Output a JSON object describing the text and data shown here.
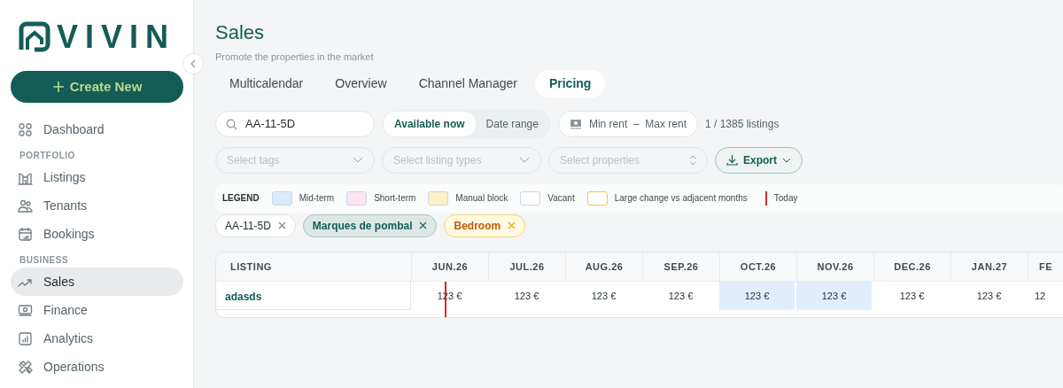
{
  "sidebar": {
    "logo": "VIVIN",
    "create_button": "Create New",
    "items": [
      {
        "kind": "item",
        "label": "Dashboard",
        "selected": false
      },
      {
        "kind": "section",
        "label": "PORTFOLIO"
      },
      {
        "kind": "item",
        "label": "Listings",
        "selected": false
      },
      {
        "kind": "item",
        "label": "Tenants",
        "selected": false
      },
      {
        "kind": "item",
        "label": "Bookings",
        "selected": false
      },
      {
        "kind": "section",
        "label": "BUSINESS"
      },
      {
        "kind": "item",
        "label": "Sales",
        "selected": true
      },
      {
        "kind": "item",
        "label": "Finance",
        "selected": false
      },
      {
        "kind": "item",
        "label": "Analytics",
        "selected": false
      },
      {
        "kind": "item",
        "label": "Operations",
        "selected": false
      }
    ]
  },
  "header": {
    "title": "Sales",
    "subtitle": "Promote the properties in the market"
  },
  "tabs": [
    {
      "label": "Multicalendar",
      "selected": false
    },
    {
      "label": "Overview",
      "selected": false
    },
    {
      "label": "Channel Manager",
      "selected": false
    },
    {
      "label": "Pricing",
      "selected": true
    }
  ],
  "search": {
    "value": "AA-11-5D"
  },
  "availability": [
    {
      "label": "Available now",
      "selected": true
    },
    {
      "label": "Date range",
      "selected": false
    }
  ],
  "rent": {
    "min": "Min rent",
    "separator": "–",
    "max": "Max rent"
  },
  "listing_count": "1 / 1385 listings",
  "filters": [
    {
      "placeholder": "Select tags",
      "kind": "dropdown"
    },
    {
      "placeholder": "Select listing types",
      "kind": "dropdown"
    },
    {
      "placeholder": "Select properties",
      "kind": "sort"
    }
  ],
  "export_button": "Export",
  "legend": {
    "title": "LEGEND",
    "items": [
      {
        "label": "Mid-term",
        "kind": "swatch",
        "color": "#dce9fc"
      },
      {
        "label": "Short-term",
        "kind": "swatch",
        "color": "#fce4f0"
      },
      {
        "label": "Manual block",
        "kind": "swatch",
        "color": "#fdf0c4"
      },
      {
        "label": "Vacant",
        "kind": "swatch",
        "color": "#ffffff"
      },
      {
        "label": "Large change vs adjacent months",
        "kind": "outline",
        "color": "#f2c744"
      },
      {
        "label": "Today",
        "kind": "line",
        "color": "#d9262c"
      }
    ]
  },
  "active_filters": [
    {
      "label": "AA-11-5D",
      "kind": "search"
    },
    {
      "label": "Marques de pombal",
      "kind": "property"
    },
    {
      "label": "Bedroom",
      "kind": "type"
    }
  ],
  "table": {
    "columns": [
      "LISTING",
      "JUN.26",
      "JUL.26",
      "AUG.26",
      "SEP.26",
      "OCT.26",
      "NOV.26",
      "DEC.26",
      "JAN.27",
      "FE"
    ],
    "rows": [
      {
        "cells": [
          {
            "text": "adasds",
            "kind": "listing"
          },
          {
            "text": "123 €",
            "kind": "vacant",
            "today": true
          },
          {
            "text": "123 €",
            "kind": "vacant"
          },
          {
            "text": "123 €",
            "kind": "vacant"
          },
          {
            "text": "123 €",
            "kind": "vacant"
          },
          {
            "text": "123 €",
            "kind": "mid-term"
          },
          {
            "text": "123 €",
            "kind": "mid-term"
          },
          {
            "text": "123 €",
            "kind": "vacant"
          },
          {
            "text": "123 €",
            "kind": "vacant"
          },
          {
            "text": "12",
            "kind": "vacant"
          }
        ]
      }
    ]
  }
}
